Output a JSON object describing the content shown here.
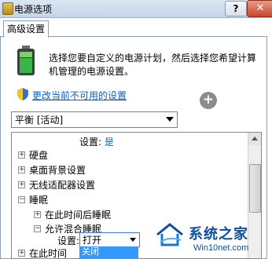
{
  "window": {
    "title": "电源选项",
    "help_label": "?",
    "close_label": "✕"
  },
  "tab": {
    "label": "高级设置"
  },
  "description": "选择您要自定义的电源计划，然后选择您希望计算机管理的电源设置。",
  "link": {
    "label": "更改当前不可用的设置"
  },
  "plus_label": "+",
  "plan_combo": {
    "value": "平衡 [活动]"
  },
  "tree": {
    "items": [
      {
        "label": "设置:",
        "value": "是"
      },
      {
        "toggle": "+",
        "label": "硬盘"
      },
      {
        "toggle": "+",
        "label": "桌面背景设置"
      },
      {
        "toggle": "+",
        "label": "无线适配器设置"
      },
      {
        "toggle": "−",
        "label": "睡眠"
      },
      {
        "toggle": "+",
        "label": "在此时间后睡眠"
      },
      {
        "toggle": "−",
        "label": "允许混合睡眠"
      },
      {
        "toggle": "+",
        "label": "在此时间"
      }
    ],
    "inline_setting": {
      "label": "设置:",
      "value": "打开",
      "option": "关闭"
    }
  },
  "watermark": {
    "title": "系统之家",
    "url": "Win10net.com"
  },
  "colors": {
    "link": "#0b5fbf",
    "selection": "#3399ff",
    "titlebar": "#c4d5ea"
  }
}
